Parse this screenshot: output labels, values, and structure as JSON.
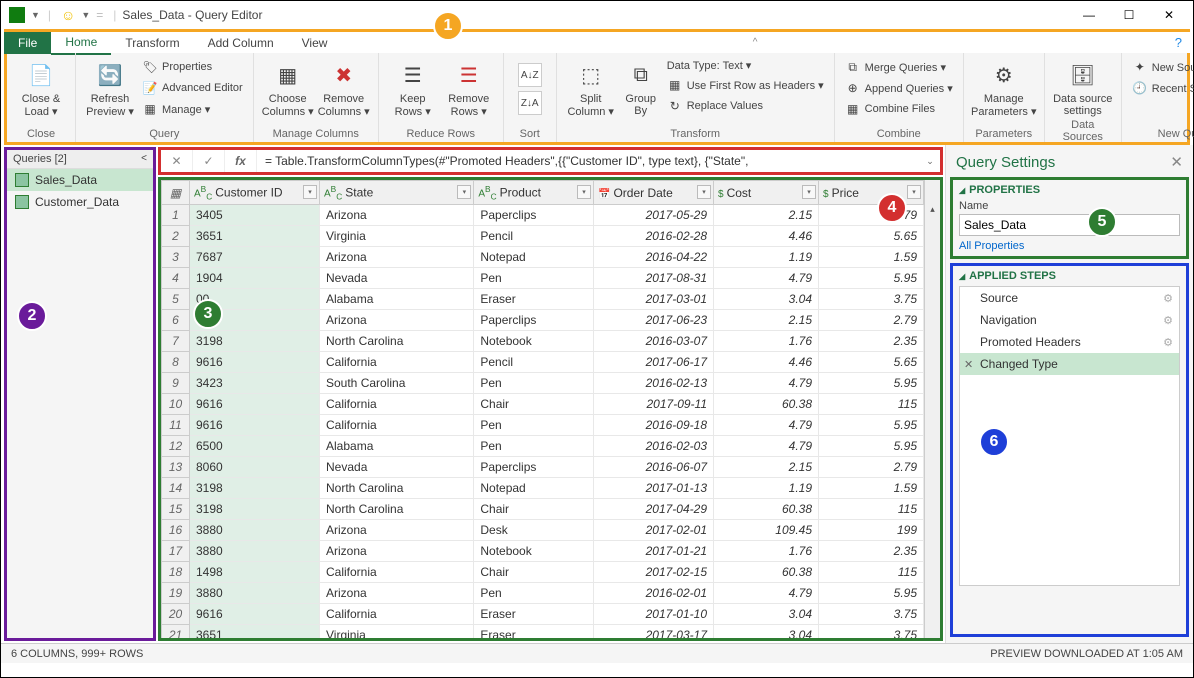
{
  "window": {
    "title": "Sales_Data - Query Editor"
  },
  "tabs": {
    "file": "File",
    "home": "Home",
    "transform": "Transform",
    "add_col": "Add Column",
    "view": "View"
  },
  "ribbon": {
    "close": {
      "label": "Close &\nLoad ▾",
      "group": "Close"
    },
    "refresh": {
      "label": "Refresh\nPreview ▾"
    },
    "properties": "Properties",
    "adv_editor": "Advanced Editor",
    "manage": "Manage ▾",
    "query_group": "Query",
    "choose_cols": "Choose\nColumns ▾",
    "remove_cols": "Remove\nColumns ▾",
    "manage_cols_group": "Manage Columns",
    "keep_rows": "Keep\nRows ▾",
    "remove_rows": "Remove\nRows ▾",
    "reduce_group": "Reduce Rows",
    "sort_group": "Sort",
    "split_col": "Split\nColumn ▾",
    "group_by": "Group\nBy",
    "data_type": "Data Type: Text ▾",
    "first_row": "Use First Row as Headers ▾",
    "replace": "Replace Values",
    "transform_group": "Transform",
    "merge": "Merge Queries ▾",
    "append": "Append Queries ▾",
    "combine_files": "Combine Files",
    "combine_group": "Combine",
    "manage_params": "Manage\nParameters ▾",
    "params_group": "Parameters",
    "data_source": "Data source\nsettings",
    "ds_group": "Data Sources",
    "new_source": "New Source ▾",
    "recent": "Recent Sources ▾",
    "new_query_group": "New Query"
  },
  "queries": {
    "header": "Queries [2]",
    "items": [
      "Sales_Data",
      "Customer_Data"
    ]
  },
  "formula": "= Table.TransformColumnTypes(#\"Promoted Headers\",{{\"Customer ID\", type text}, {\"State\",",
  "columns": [
    "Customer ID",
    "State",
    "Product",
    "Order Date",
    "Cost",
    "Price"
  ],
  "rows": [
    [
      "3405",
      "Arizona",
      "Paperclips",
      "2017-05-29",
      "2.15",
      "2.79"
    ],
    [
      "3651",
      "Virginia",
      "Pencil",
      "2016-02-28",
      "4.46",
      "5.65"
    ],
    [
      "7687",
      "Arizona",
      "Notepad",
      "2016-04-22",
      "1.19",
      "1.59"
    ],
    [
      "1904",
      "Nevada",
      "Pen",
      "2017-08-31",
      "4.79",
      "5.95"
    ],
    [
      "00",
      "Alabama",
      "Eraser",
      "2017-03-01",
      "3.04",
      "3.75"
    ],
    [
      "87",
      "Arizona",
      "Paperclips",
      "2017-06-23",
      "2.15",
      "2.79"
    ],
    [
      "3198",
      "North Carolina",
      "Notebook",
      "2016-03-07",
      "1.76",
      "2.35"
    ],
    [
      "9616",
      "California",
      "Pencil",
      "2017-06-17",
      "4.46",
      "5.65"
    ],
    [
      "3423",
      "South Carolina",
      "Pen",
      "2016-02-13",
      "4.79",
      "5.95"
    ],
    [
      "9616",
      "California",
      "Chair",
      "2017-09-11",
      "60.38",
      "115"
    ],
    [
      "9616",
      "California",
      "Pen",
      "2016-09-18",
      "4.79",
      "5.95"
    ],
    [
      "6500",
      "Alabama",
      "Pen",
      "2016-02-03",
      "4.79",
      "5.95"
    ],
    [
      "8060",
      "Nevada",
      "Paperclips",
      "2016-06-07",
      "2.15",
      "2.79"
    ],
    [
      "3198",
      "North Carolina",
      "Notepad",
      "2017-01-13",
      "1.19",
      "1.59"
    ],
    [
      "3198",
      "North Carolina",
      "Chair",
      "2017-04-29",
      "60.38",
      "115"
    ],
    [
      "3880",
      "Arizona",
      "Desk",
      "2017-02-01",
      "109.45",
      "199"
    ],
    [
      "3880",
      "Arizona",
      "Notebook",
      "2017-01-21",
      "1.76",
      "2.35"
    ],
    [
      "1498",
      "California",
      "Chair",
      "2017-02-15",
      "60.38",
      "115"
    ],
    [
      "3880",
      "Arizona",
      "Pen",
      "2016-02-01",
      "4.79",
      "5.95"
    ],
    [
      "9616",
      "California",
      "Eraser",
      "2017-01-10",
      "3.04",
      "3.75"
    ],
    [
      "3651",
      "Virginia",
      "Eraser",
      "2017-03-17",
      "3.04",
      "3.75"
    ]
  ],
  "settings": {
    "title": "Query Settings",
    "properties": "PROPERTIES",
    "name_label": "Name",
    "name_value": "Sales_Data",
    "all_props": "All Properties",
    "applied_steps": "APPLIED STEPS",
    "steps": [
      "Source",
      "Navigation",
      "Promoted Headers",
      "Changed Type"
    ]
  },
  "status": {
    "left": "6 COLUMNS, 999+ ROWS",
    "right": "PREVIEW DOWNLOADED AT 1:05 AM"
  },
  "callouts": {
    "c1": "1",
    "c2": "2",
    "c3": "3",
    "c4": "4",
    "c5": "5",
    "c6": "6"
  }
}
